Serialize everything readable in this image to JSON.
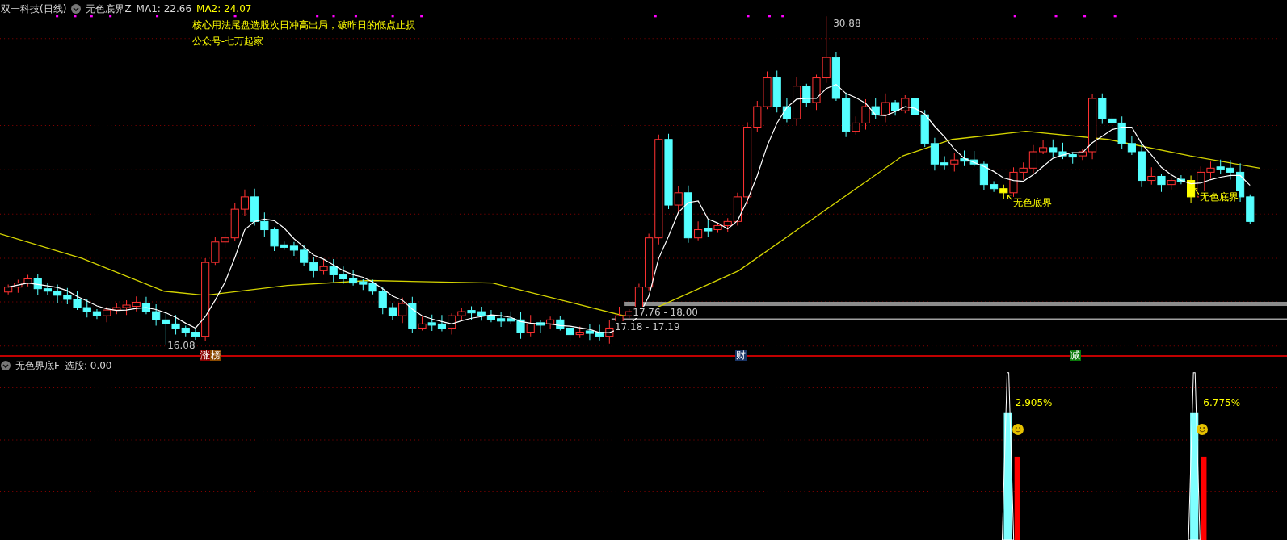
{
  "header": {
    "stock": "双一科技(日线)",
    "indicator": "无色底界Z",
    "ma1": "MA1: 22.66",
    "ma2": "MA2: 24.07"
  },
  "notes": [
    "核心用法尾盘选股次日冲高出局，破昨日的低点止损",
    "公众号-七万起家"
  ],
  "price_labels": [
    {
      "kind": "high",
      "text": "30.88"
    },
    {
      "kind": "low",
      "text": "16.08"
    },
    {
      "kind": "band",
      "text": "17.76 - 18.00"
    },
    {
      "kind": "band",
      "text": "17.18 - 17.19"
    }
  ],
  "signals": [
    "无色底界",
    "无色底界"
  ],
  "event_tags": [
    {
      "text": "涨",
      "color": "#8b0000"
    },
    {
      "text": "榜",
      "color": "#8b4a00"
    },
    {
      "text": "财",
      "color": "#1a3566"
    },
    {
      "text": "减",
      "color": "#0a7a0a"
    }
  ],
  "lower": {
    "indicator": "无色界底F",
    "reading": "选股: 0.00",
    "percents": [
      "2.905%",
      "6.775%"
    ]
  }
}
